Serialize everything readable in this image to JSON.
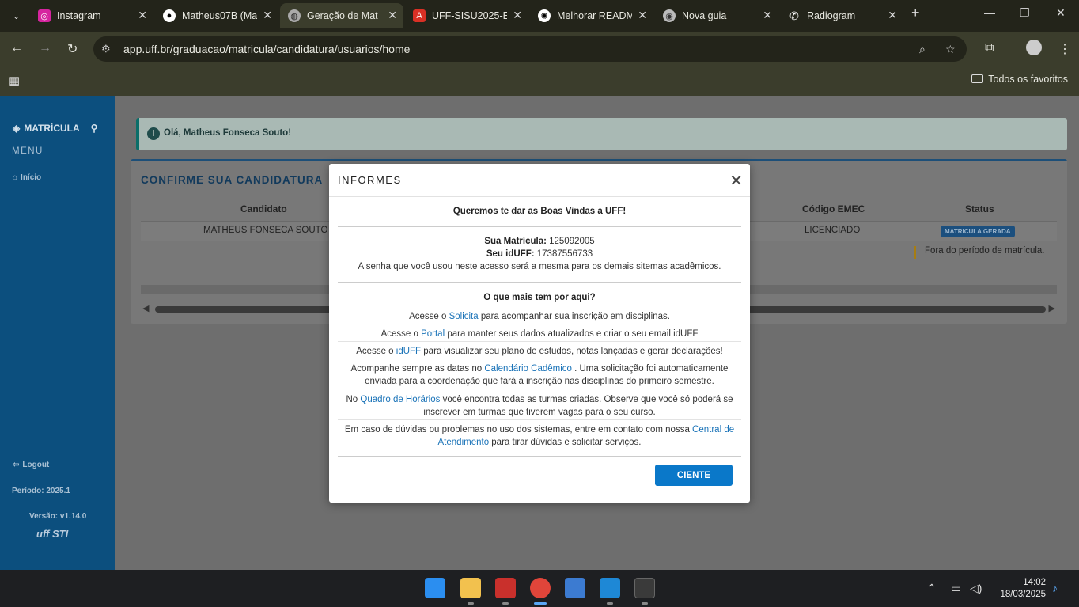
{
  "browser": {
    "tabs": [
      {
        "title": "Instagram",
        "icon": "instagram-icon",
        "color": "#d6249f"
      },
      {
        "title": "Matheus07B (Ma",
        "icon": "github-icon",
        "color": "#ffffff"
      },
      {
        "title": "Geração de Mat",
        "icon": "globe-icon",
        "color": "#cccccc"
      },
      {
        "title": "UFF-SISU2025-E",
        "icon": "pdf-icon",
        "color": "#d93025"
      },
      {
        "title": "Melhorar READM",
        "icon": "openai-icon",
        "color": "#ffffff"
      },
      {
        "title": "Nova guia",
        "icon": "chrome-icon",
        "color": "#cccccc"
      },
      {
        "title": "Radiogram",
        "icon": "phone-icon",
        "color": "#ffffff"
      }
    ],
    "url": "app.uff.br/graduacao/matricula/candidatura/usuarios/home",
    "bookmarks_all": "Todos os favoritos"
  },
  "sidebar": {
    "brand": "MATRÍCULA",
    "menu": "MENU",
    "inicio": "Início",
    "logout": "Logout",
    "periodo": "Período: 2025.1",
    "versao": "Versão: v1.14.0",
    "logo": "uff STI"
  },
  "alert": {
    "text": "Olá, Matheus Fonseca Souto!"
  },
  "card": {
    "title": "CONFIRME SUA CANDIDATURA",
    "headers": {
      "candidato": "Candidato",
      "emec": "Código EMEC",
      "status": "Status"
    },
    "row": {
      "candidato": "MATHEUS FONSECA SOUTO",
      "emec": "LICENCIADO",
      "status": "MATRICULA GERADA"
    },
    "note": "Fora do período de matrícula."
  },
  "modal": {
    "title": "INFORMES",
    "welcome": "Queremos te dar as Boas Vindas a UFF!",
    "matricula_label": "Sua Matrícula:",
    "matricula_value": "125092005",
    "iduff_label": "Seu idUFF:",
    "iduff_value": "17387556733",
    "senha": "A senha que você usou neste acesso será a mesma para os demais sitemas acadêmicos.",
    "more_title": "O que mais tem por aqui?",
    "l1_pre": "Acesse o ",
    "l1_link": "Solicita",
    "l1_post": " para acompanhar sua inscrição em disciplinas.",
    "l2_pre": "Acesse o ",
    "l2_link": "Portal",
    "l2_post": " para manter seus dados atualizados e criar o seu email idUFF",
    "l3_pre": "Acesse o ",
    "l3_link": "idUFF",
    "l3_post": " para visualizar seu plano de estudos, notas lançadas e gerar declarações!",
    "l4_pre": "Acompanhe sempre as datas no ",
    "l4_link": "Calendário Cadêmico",
    "l4_post": " . Uma solicitação foi automaticamente enviada para a coordenação que fará a inscrição nas disciplinas do primeiro semestre.",
    "l5_pre": "No ",
    "l5_link": "Quadro de Horários",
    "l5_post": " você encontra todas as turmas criadas. Observe que você só poderá se inscrever em turmas que tiverem vagas para o seu curso.",
    "l6_pre": "Em caso de dúvidas ou problemas no uso dos sistemas, entre em contato com nossa ",
    "l6_link": "Central de Atendimento",
    "l6_post": " para tirar dúvidas e solicitar serviços.",
    "button": "CIENTE"
  },
  "taskbar": {
    "time": "14:02",
    "date": "18/03/2025"
  }
}
